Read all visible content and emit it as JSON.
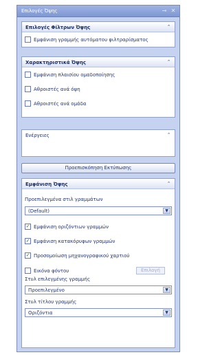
{
  "window": {
    "title": "Επιλογές Όψης",
    "pin_icon": "pin-icon",
    "close_icon": "close-icon"
  },
  "filters_panel": {
    "title": "Επιλογές Φίλτρων Όψης",
    "options": [
      {
        "label": "Εμφάνιση γραμμής αυτόματου φιλτραρίσματος",
        "checked": false
      }
    ]
  },
  "features_panel": {
    "title": "Χαρακτηριστικά Όψης",
    "options": [
      {
        "label": "Εμφάνιση πλαισίου ομαδοποίησης",
        "checked": false
      },
      {
        "label": "Αθροιστές ανά όψη",
        "checked": false
      },
      {
        "label": "Αθροιστές ανά ομάδα",
        "checked": false
      }
    ]
  },
  "actions_panel": {
    "title": "Ενέργειες"
  },
  "preview_button": "Προεπισκόπηση Εκτύπωσης",
  "display_panel": {
    "title": "Εμφάνιση Όψης",
    "predefined_label": "Προεπιλεγμένα στιλ γραμμάτων",
    "predefined_value": "(Default)",
    "options": [
      {
        "label": "Εμφάνιση οριζόντιων γραμμών",
        "checked": true
      },
      {
        "label": "Εμφάνιση κατακόρυφων γραμμών",
        "checked": true
      },
      {
        "label": "Προσομοίωση μηχανογραφικού χαρτιού",
        "checked": true
      }
    ],
    "background": {
      "label": "Εικόνα φόντου",
      "checked": false,
      "button": "Επιλογή"
    },
    "row_style_label": "Στυλ επιλεγμένης γραμμής",
    "row_style_value": "Προεπιλεγμένο",
    "title_style_label": "Στυλ τίτλου γραμμής",
    "title_style_value": "Οριζόντια"
  }
}
